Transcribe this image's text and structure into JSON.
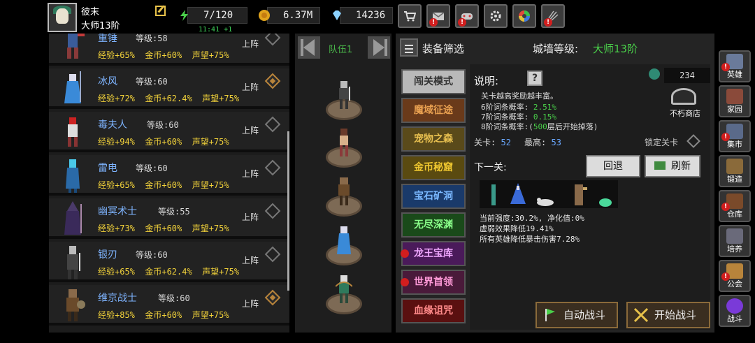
{
  "player": {
    "name": "彼末",
    "rank": "大师13阶"
  },
  "resources": {
    "energy": "7/120",
    "energy_timer": "11:41 +1",
    "gold": "6.37M",
    "diamond": "14236"
  },
  "toolbar_icons": [
    "shop-icon",
    "mail-icon",
    "gamepad-icon",
    "settings-icon",
    "color-wheel-icon",
    "fireworks-icon"
  ],
  "heroes": [
    {
      "name": "重锤",
      "level": "等级:58",
      "stats": "经验+65%  金币+60%  声望+75%",
      "deploy": "上阵",
      "selected": false
    },
    {
      "name": "冰风",
      "level": "等级:60",
      "stats": "经验+72%  金币+62.4%  声望+75%",
      "deploy": "上阵",
      "selected": true
    },
    {
      "name": "毒夫人",
      "level": "等级:60",
      "stats": "经验+94%  金币+60%  声望+75%",
      "deploy": "上阵",
      "selected": false
    },
    {
      "name": "雷电",
      "level": "等级:60",
      "stats": "经验+65%  金币+60%  声望+75%",
      "deploy": "上阵",
      "selected": false
    },
    {
      "name": "幽冥术士",
      "level": "等级:55",
      "stats": "经验+73%  金币+60%  声望+75%",
      "deploy": "上阵",
      "selected": false
    },
    {
      "name": "银刃",
      "level": "等级:60",
      "stats": "经验+65%  金币+62.4%  声望+75%",
      "deploy": "上阵",
      "selected": false
    },
    {
      "name": "维京战士",
      "level": "等级:60",
      "stats": "经验+85%  金币+60%  声望+75%",
      "deploy": "上阵",
      "selected": true
    }
  ],
  "team": {
    "title": "队伍1"
  },
  "panel": {
    "filter_label": "装备筛选",
    "wall_label": "城墙等级:",
    "wall_level": "大师13阶"
  },
  "modes": [
    {
      "label": "闯关模式",
      "alert": false
    },
    {
      "label": "魔域征途",
      "alert": false
    },
    {
      "label": "宠物之森",
      "alert": false
    },
    {
      "label": "金币秘窟",
      "alert": false
    },
    {
      "label": "宝石矿洞",
      "alert": false
    },
    {
      "label": "无尽深渊",
      "alert": false
    },
    {
      "label": "龙王宝库",
      "alert": true
    },
    {
      "label": "世界首领",
      "alert": true
    },
    {
      "label": "血缘诅咒",
      "alert": false
    }
  ],
  "info": {
    "desc_label": "说明:",
    "question": "?",
    "gem_count": "234",
    "shop_label": "不朽商店",
    "desc_lines": [
      "关卡越高奖励越丰富。"
    ],
    "tier6_label": "6阶词条概率:",
    "tier6_value": "2.51%",
    "tier7_label": "7阶词条概率:",
    "tier7_value": "0.15%",
    "tier8_label": "8阶词条概率:(",
    "tier8_value": "500",
    "tier8_suffix": "层后开始掉落)",
    "stage_label": "关卡:",
    "stage_value": "52",
    "max_label": "最高:",
    "max_value": "53",
    "lock_label": "锁定关卡",
    "next_label": "下一关:",
    "back_label": "回退",
    "refresh_label": "刷新",
    "effects": [
      "当前强度:30.2%, 净化值:0%",
      "虚弱效果降低19.41%",
      "所有英雄降低暴击伤害7.28%"
    ]
  },
  "actions": {
    "auto_fight": "自动战斗",
    "start_fight": "开始战斗"
  },
  "sidebar": [
    {
      "label": "英雄",
      "alert": true
    },
    {
      "label": "家园",
      "alert": false
    },
    {
      "label": "集市",
      "alert": true
    },
    {
      "label": "锻造",
      "alert": false
    },
    {
      "label": "仓库",
      "alert": true
    },
    {
      "label": "培养",
      "alert": false
    },
    {
      "label": "公会",
      "alert": true
    },
    {
      "label": "战斗",
      "alert": false
    }
  ],
  "colors": {
    "gold_text": "#f2d23a",
    "hero_name": "#7eb4ff",
    "accent_green": "#4ad04a",
    "alert_red": "#d21e1e"
  }
}
